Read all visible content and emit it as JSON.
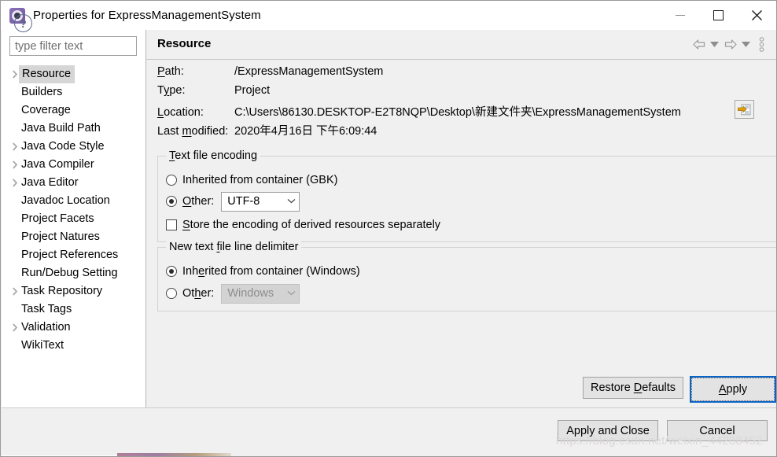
{
  "window": {
    "title": "Properties for ExpressManagementSystem",
    "app_icon": "gear-icon",
    "minimize_label": "Minimize",
    "maximize_label": "Maximize",
    "close_label": "Close"
  },
  "sidebar": {
    "filter_placeholder": "type filter text",
    "items": [
      {
        "label": "Resource",
        "expandable": true,
        "selected": true
      },
      {
        "label": "Builders",
        "expandable": false,
        "selected": false
      },
      {
        "label": "Coverage",
        "expandable": false,
        "selected": false
      },
      {
        "label": "Java Build Path",
        "expandable": false,
        "selected": false
      },
      {
        "label": "Java Code Style",
        "expandable": true,
        "selected": false
      },
      {
        "label": "Java Compiler",
        "expandable": true,
        "selected": false
      },
      {
        "label": "Java Editor",
        "expandable": true,
        "selected": false
      },
      {
        "label": "Javadoc Location",
        "expandable": false,
        "selected": false
      },
      {
        "label": "Project Facets",
        "expandable": false,
        "selected": false
      },
      {
        "label": "Project Natures",
        "expandable": false,
        "selected": false
      },
      {
        "label": "Project References",
        "expandable": false,
        "selected": false
      },
      {
        "label": "Run/Debug Setting",
        "expandable": false,
        "selected": false
      },
      {
        "label": "Task Repository",
        "expandable": true,
        "selected": false
      },
      {
        "label": "Task Tags",
        "expandable": false,
        "selected": false
      },
      {
        "label": "Validation",
        "expandable": true,
        "selected": false
      },
      {
        "label": "WikiText",
        "expandable": false,
        "selected": false
      }
    ],
    "scroll_left_icon": "chevron-left-icon",
    "scroll_right_icon": "chevron-right-icon"
  },
  "page": {
    "title": "Resource",
    "toolbar": {
      "back_icon": "back-arrow-icon",
      "back_menu_icon": "caret-down-icon",
      "forward_icon": "forward-arrow-icon",
      "forward_menu_icon": "caret-down-icon",
      "view_menu_icon": "vertical-dots-icon"
    },
    "fields": [
      {
        "label": "Path:",
        "mnemonic": "P",
        "value": "/ExpressManagementSystem"
      },
      {
        "label": "Type:",
        "mnemonic": "y",
        "value": "Project"
      },
      {
        "label": "Location:",
        "mnemonic": "L",
        "value": "C:\\Users\\86130.DESKTOP-E2T8NQP\\Desktop\\新建文件夹\\ExpressManagementSystem"
      },
      {
        "label": "Last modified:",
        "mnemonic": "m",
        "value": "2020年4月16日 下午6:09:44"
      }
    ],
    "location_button_icon": "open-folder-link-icon",
    "encoding_group": {
      "title": "Text file encoding",
      "title_mnemonic": "T",
      "inherited_label": "Inherited from container (GBK)",
      "inherited_mnemonic": "I",
      "inherited_selected": false,
      "other_label": "Other:",
      "other_mnemonic": "O",
      "other_selected": true,
      "other_value": "UTF-8",
      "store_label": "Store the encoding of derived resources separately",
      "store_mnemonic": "S",
      "store_checked": false
    },
    "delimiter_group": {
      "title": "New text file line delimiter",
      "title_mnemonic": "f",
      "inherited_label": "Inherited from container (Windows)",
      "inherited_mnemonic": "e",
      "inherited_selected": true,
      "other_label": "Other:",
      "other_mnemonic": "h",
      "other_selected": false,
      "other_value": "Windows",
      "other_disabled": true
    },
    "restore_defaults_label": "Restore Defaults",
    "restore_defaults_mnemonic": "D",
    "apply_label": "Apply",
    "apply_mnemonic": "A"
  },
  "footer": {
    "help_icon": "question-mark-icon",
    "apply_and_close_label": "Apply and Close",
    "cancel_label": "Cancel"
  },
  "watermark": "https://blog.csdn.net/weixin_44288452",
  "colors": {
    "window_bg": "#f0f0f0",
    "panel_bg": "#ffffff",
    "selection": "#d6d6d6",
    "focus_ring": "#0a64c8",
    "accent_icon": "#e3a008"
  }
}
